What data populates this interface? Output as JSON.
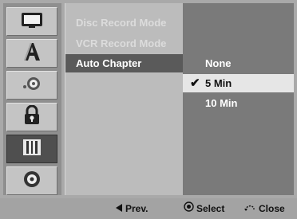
{
  "menu": {
    "items": [
      {
        "label": "Disc Record Mode",
        "state": "disabled"
      },
      {
        "label": "VCR Record Mode",
        "state": "disabled"
      },
      {
        "label": "Auto Chapter",
        "state": "active"
      }
    ]
  },
  "options": {
    "items": [
      {
        "label": "None",
        "checked": false
      },
      {
        "label": "5 Min",
        "checked": true
      },
      {
        "label": "10 Min",
        "checked": false
      }
    ]
  },
  "sidebar": {
    "icons": [
      "display-icon",
      "language-icon",
      "audio-icon",
      "lock-icon",
      "recording-icon",
      "disc-icon"
    ],
    "active_index": 4
  },
  "footer": {
    "prev_label": "Prev.",
    "select_label": "Select",
    "close_label": "Close"
  },
  "colors": {
    "active_row": "#5a5a5a",
    "highlight_row": "#e6e6e6"
  }
}
